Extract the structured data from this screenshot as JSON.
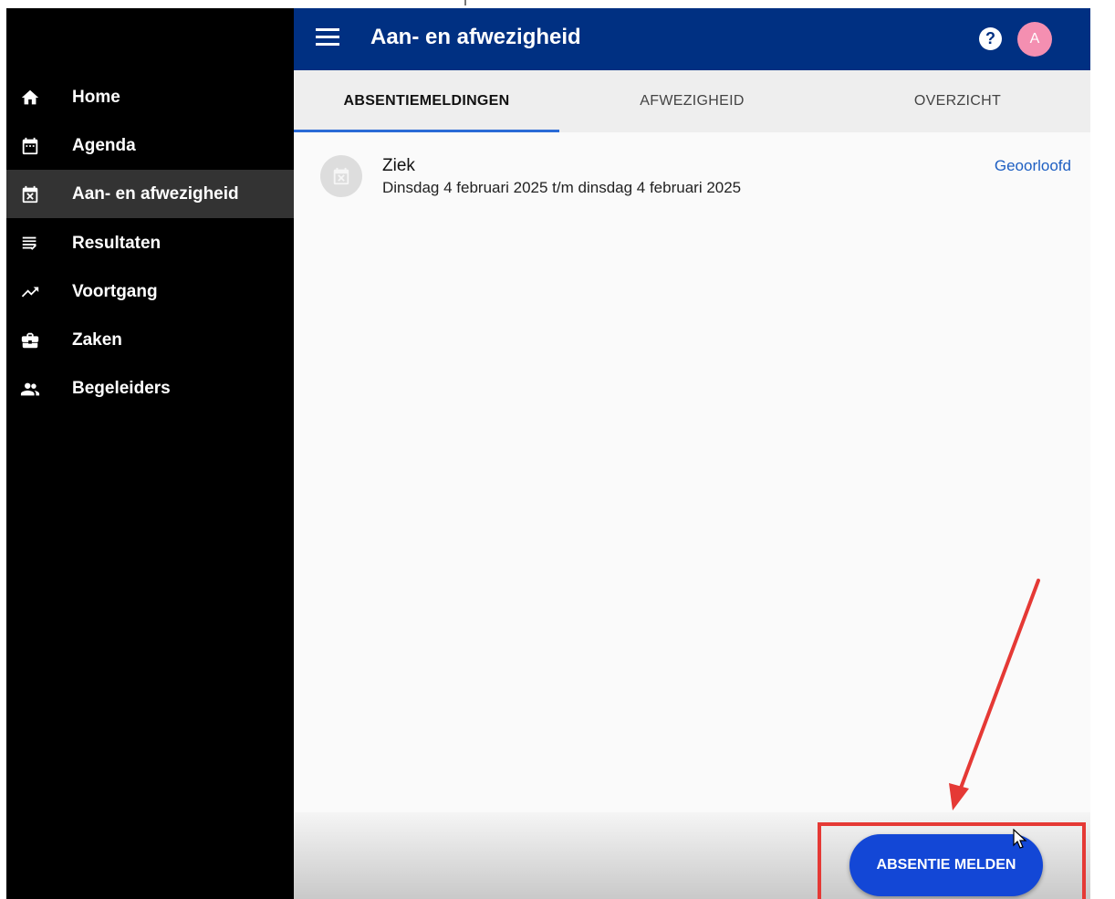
{
  "app": {
    "title": "Aan- en afwezigheid"
  },
  "header": {
    "help_label": "?",
    "avatar_initial": "A"
  },
  "sidebar": {
    "items": [
      {
        "label": "Home",
        "icon": "home-icon"
      },
      {
        "label": "Agenda",
        "icon": "calendar-icon"
      },
      {
        "label": "Aan- en afwezigheid",
        "icon": "calendar-x-icon",
        "active": true
      },
      {
        "label": "Resultaten",
        "icon": "results-list-icon"
      },
      {
        "label": "Voortgang",
        "icon": "trending-up-icon"
      },
      {
        "label": "Zaken",
        "icon": "briefcase-icon"
      },
      {
        "label": "Begeleiders",
        "icon": "people-icon"
      }
    ]
  },
  "tabs": [
    {
      "label": "ABSENTIEMELDINGEN",
      "active": true
    },
    {
      "label": "AFWEZIGHEID"
    },
    {
      "label": "OVERZICHT"
    }
  ],
  "absences": [
    {
      "title": "Ziek",
      "period": "Dinsdag 4 februari 2025 t/m dinsdag 4 februari 2025",
      "status": "Geoorloofd",
      "icon": "calendar-x-icon"
    }
  ],
  "actions": {
    "report_absence_label": "ABSENTIE MELDEN"
  },
  "colors": {
    "appbar": "#003082",
    "accent": "#1347d6",
    "status_link": "#1e5fc2",
    "annotation": "#e53935",
    "sidebar_bg": "#000000",
    "sidebar_active": "#333333"
  }
}
